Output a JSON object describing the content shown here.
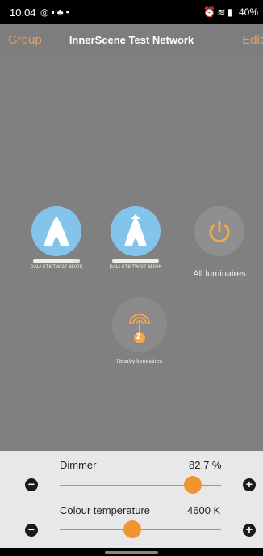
{
  "status_bar": {
    "time": "10:04",
    "left_icons": [
      "whatsapp-icon",
      "notification-icon",
      "app-icon",
      "dot-icon"
    ],
    "right_icons": [
      "alarm-icon",
      "wifi-icon",
      "signal-icon"
    ],
    "battery": "40%"
  },
  "header": {
    "left_label": "Group",
    "title": "InnerScene Test Network",
    "right_label": "Edit"
  },
  "devices": [
    {
      "label": "DALI CT8 TW 27-6500K",
      "icon": "luminaire-a-icon",
      "brightness": 0.85,
      "color": "#82c4ea"
    },
    {
      "label": "DALI CT8 TW 27-6500K",
      "icon": "luminaire-arrow-icon",
      "brightness": 0.95,
      "color": "#82c4ea"
    },
    {
      "label": "All luminaires",
      "icon": "power-icon"
    },
    {
      "label": "Nearby luminaires",
      "icon": "nearby-antenna-icon",
      "count": "2"
    }
  ],
  "controls": {
    "dimmer": {
      "label": "Dimmer",
      "value": "82.7 %",
      "level": 0.827
    },
    "colour_temperature": {
      "label": "Colour temperature",
      "value": "4600 K",
      "level": 0.45
    }
  },
  "accent_color": "#ef9431"
}
